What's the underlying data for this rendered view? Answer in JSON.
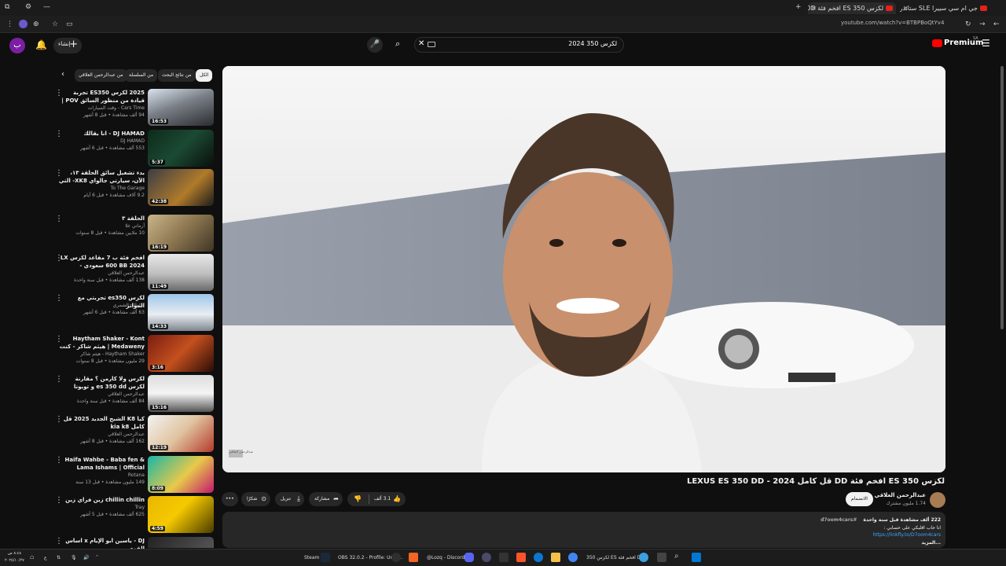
{
  "browser": {
    "tabs": [
      {
        "label": "جي ام سي سييرا SLE ستاندر 2024",
        "active": false
      },
      {
        "label": "لكزس 350 ES افخم فئة DD قل",
        "active": true
      },
      {
        "label": "لكزس 350 ES افخم فئة DD قل",
        "active": false
      }
    ],
    "url": "youtube.com/watch?v=BTBPBoQtYv4",
    "new_tab": "+"
  },
  "header": {
    "brand": "Premium",
    "brand_sup": "SA",
    "search_value": "لكزس 350 2024",
    "create_label": "إنشاء",
    "avatar_letter": "ب"
  },
  "chips": [
    "الكل",
    "من نتائج البحث",
    "من السلسلة",
    "من عبدالرحمن العلاقي"
  ],
  "videos": [
    {
      "title": "2025 لكزس ES350 تجربة قيادة من منظور السائق POV | مفهوم السيدان المثالي...",
      "channel": "Cars Time - وقت السيارات",
      "meta": "94 ألف مشاهدة • قبل 8 أشهر",
      "duration": "16:53"
    },
    {
      "title": "DJ HAMAD - انا بقالك",
      "channel": "DJ HAMAD",
      "meta": "553 ألف مشاهدة • قبل 6 أشهر",
      "duration": "5:37"
    },
    {
      "title": "بدء تشغيل سائق الحلقة ١٣، الآن، سيارتي جالواي XK8- التي تعاني من مشاكل كثيرة...",
      "channel": "To The Garage",
      "meta": "9.2 آلاف مشاهدة • قبل 6 أيام",
      "duration": "42:38"
    },
    {
      "title": "الحلقة ٣",
      "channel": "أرماني غلا",
      "meta": "10 ملايين مشاهدة • قبل 8 سنوات",
      "duration": "16:19"
    },
    {
      "title": "افخم فئة ب 7 مقاعد لكزس LX 600 BB 2024 سعودي - LEXUS LX 600 BB",
      "channel": "عبدالرحمن العلاقي",
      "meta": "138 ألف مشاهدة • قبل سنة واحدة",
      "duration": "11:49"
    },
    {
      "title": "لكزس es350 تجربتي مع المواتر",
      "channel": "سلطان الشمري",
      "meta": "63 ألف مشاهدة • قبل 6 أشهر",
      "duration": "14:33"
    },
    {
      "title": "Haytham Shaker - Kont Medaweny | هيثم شاكر - كنت مداويني",
      "channel": "Haytham Shaker - هيثم شاكر",
      "meta": "29 مليون مشاهدة • قبل 8 سنوات",
      "duration": "3:16"
    },
    {
      "title": "لكزس ولا كارمن ؟ مقارنة لكزس es 350 dd و تويوتا كارمن ماجيستا - lexus es...",
      "channel": "عبدالرحمن العلاقي",
      "meta": "84 ألف مشاهدة • قبل سنة واحدة",
      "duration": "15:16"
    },
    {
      "title": "كيا K8 الشبح الجديد 2025 قل كامل kia k8",
      "channel": "عبدالرحمن العلاقي",
      "meta": "162 ألف مشاهدة • قبل 8 أشهر",
      "duration": "12:19"
    },
    {
      "title": "Haifa Wahbe - Baba fen & Lama Ishams | Official Music Video |...",
      "channel": "Rotana",
      "meta": "149 مليون مشاهدة • قبل 13 سنة",
      "duration": "8:09"
    },
    {
      "title": "chillin chillin زين فراي زين",
      "channel": "Tray",
      "meta": "625 ألف مشاهدة • قبل 5 أشهر",
      "duration": "4:59"
    },
    {
      "title": "DJ - ياسين ابو الإيام x اساس القوم",
      "channel": "",
      "meta": "",
      "duration": ""
    }
  ],
  "player": {
    "watermark": "عبدالرحمن العلاقي"
  },
  "video": {
    "title": "لكزس 350 ES افخم فئة DD قل كامل 2024 - LEXUS ES 350 DD",
    "channel": "عبدالرحمن العلاقي",
    "subscribers": "1.74 مليون مشترك",
    "join": "الانضمام",
    "likes": "3.1 ألف",
    "share": "مشاركة",
    "download": "تنزيل",
    "thanks": "شكرًا",
    "more": "•••"
  },
  "description": {
    "stats": "222 ألف مشاهدة  قبل سنة واحدة",
    "hashtag": "#d7oom4cars",
    "line1": "انا حاب اقلبكي على حسابي :",
    "link": "https://linkfly.to/D7oom4cars",
    "more": "...المزيد"
  },
  "taskbar": {
    "steam": "Steam",
    "obs": "OBS 32.0.2 - Profile: Untit...",
    "discord": "@Lozq - Discord",
    "active_window": "لكزس 350 ES افخم فئة DI",
    "clock_time": "٨:٤٨ ص",
    "clock_date": "٢٠٢٥/١٠/٢٧",
    "lang": "ع"
  },
  "colors": {
    "bg": "#0f0f0f",
    "accent": "#ff0000",
    "link": "#3ea6ff"
  }
}
